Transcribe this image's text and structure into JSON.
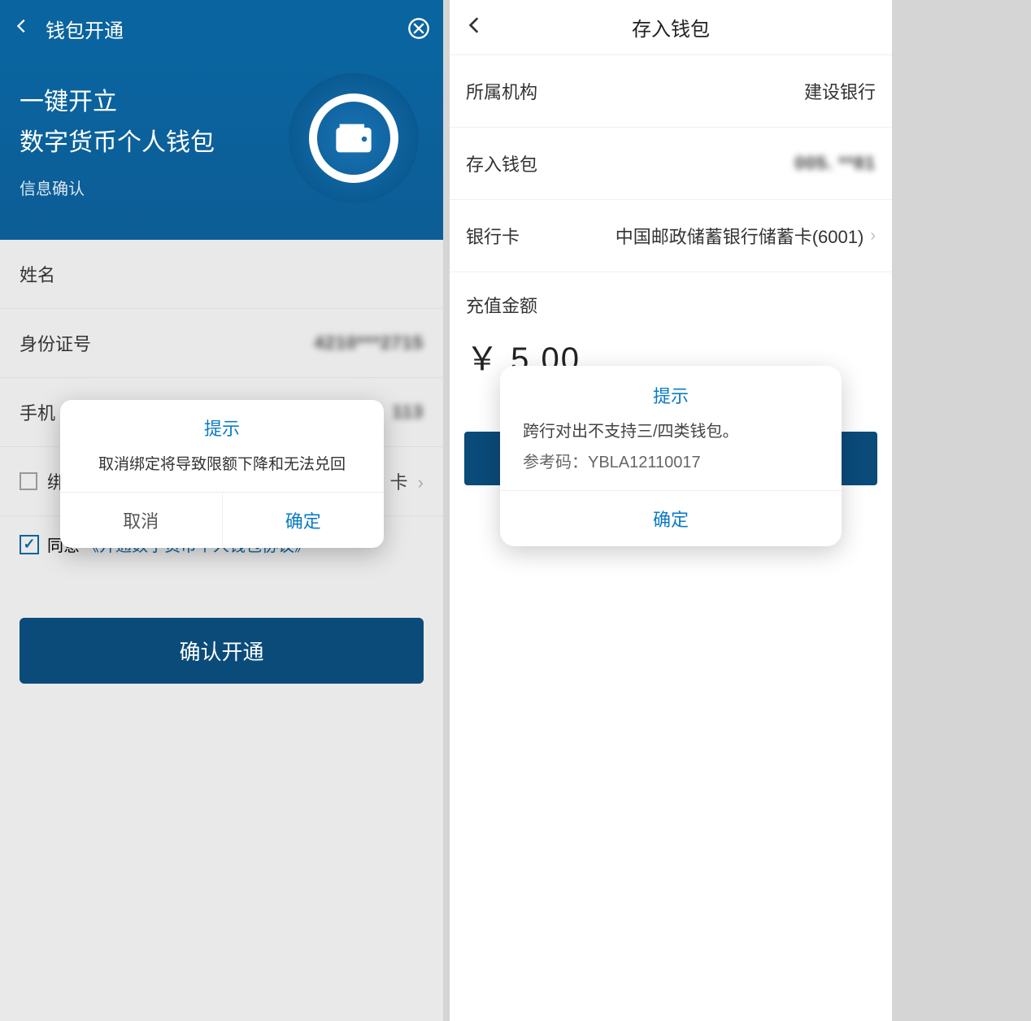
{
  "left": {
    "header": {
      "title": "钱包开通"
    },
    "hero": {
      "line1": "一键开立",
      "line2": "数字货币个人钱包",
      "sub": "信息确认"
    },
    "form": {
      "name_label": "姓名",
      "id_label": "身份证号",
      "id_value": "4210***2715",
      "phone_label": "手机",
      "phone_value": "113",
      "bind_label": "绑",
      "bind_value": "卡"
    },
    "agree": {
      "text": "同意",
      "link": "《开通数字货币个人钱包协议》"
    },
    "submit": "确认开通",
    "dialog": {
      "title": "提示",
      "message": "取消绑定将导致限额下降和无法兑回",
      "cancel": "取消",
      "ok": "确定"
    }
  },
  "right": {
    "header": {
      "title": "存入钱包"
    },
    "rows": {
      "org_label": "所属机构",
      "org_value": "建设银行",
      "wallet_label": "存入钱包",
      "wallet_value": "005. **81",
      "card_label": "银行卡",
      "card_value": "中国邮政储蓄银行储蓄卡(6001)"
    },
    "amount": {
      "label": "充值金额",
      "value": "￥ 5.00"
    },
    "dialog": {
      "title": "提示",
      "message": "跨行对出不支持三/四类钱包。",
      "ref_label": "参考码：",
      "ref_code": "YBLA12110017",
      "ok": "确定"
    }
  }
}
